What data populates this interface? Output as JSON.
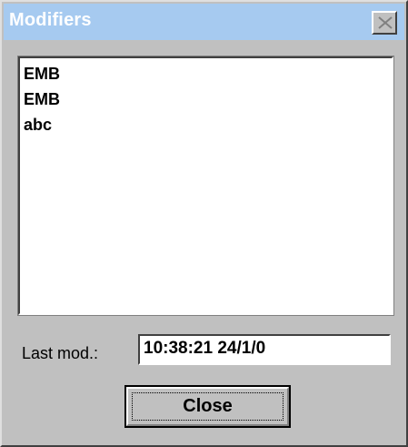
{
  "window": {
    "title": "Modifiers"
  },
  "modifiers_list": {
    "items": [
      "EMB",
      "EMB",
      "abc"
    ]
  },
  "last_mod": {
    "label": "Last mod.:",
    "value": "10:38:21 24/1/0"
  },
  "buttons": {
    "close_label": "Close"
  },
  "colors": {
    "titlebar": "#a6caf0",
    "window_face": "#c0c0c0"
  }
}
